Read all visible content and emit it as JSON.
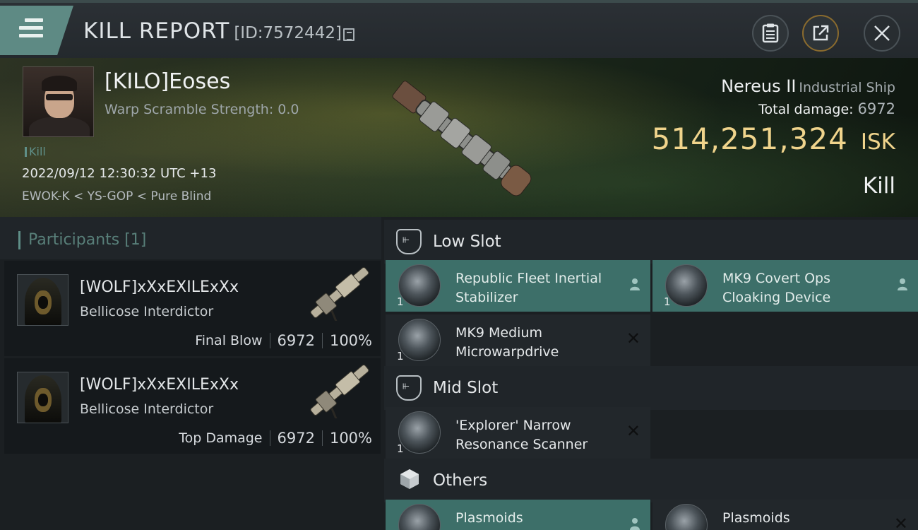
{
  "header": {
    "title": "KILL REPORT",
    "report_id": "[ID:7572442]",
    "buttons": {
      "menu": "menu-icon",
      "clipboard": "clipboard-icon",
      "share": "share-icon",
      "close": "close-icon"
    }
  },
  "victim": {
    "name": "[KILO]Eoses",
    "warp_scramble": "Warp Scramble Strength: 0.0",
    "tag": "Kill",
    "datetime": "2022/09/12 12:30:32 UTC +13",
    "location": "EWOK-K < YS-GOP < Pure Blind"
  },
  "ship": {
    "name": "Nereus II",
    "class": "Industrial Ship",
    "total_damage_label": "Total damage:",
    "total_damage": "6972",
    "isk_value": "514,251,324",
    "isk_unit": "ISK",
    "result": "Kill"
  },
  "participants": {
    "header": "Participants [1]",
    "rows": [
      {
        "name": "[WOLF]xXxEXILExXx",
        "ship": "Bellicose Interdictor",
        "role": "Final Blow",
        "damage": "6972",
        "percent": "100%"
      },
      {
        "name": "[WOLF]xXxEXILExXx",
        "ship": "Bellicose Interdictor",
        "role": "Top Damage",
        "damage": "6972",
        "percent": "100%"
      }
    ]
  },
  "slots": {
    "low": {
      "title": "Low Slot",
      "items": [
        {
          "name": "Republic Fleet Inertial Stabilizer",
          "qty": "1",
          "state": "dropped"
        },
        {
          "name": "MK9 Covert Ops Cloaking Device",
          "qty": "1",
          "state": "dropped"
        },
        {
          "name": "MK9 Medium Microwarpdrive",
          "qty": "1",
          "state": "destroyed"
        }
      ]
    },
    "mid": {
      "title": "Mid Slot",
      "items": [
        {
          "name": "'Explorer' Narrow Resonance Scanner",
          "qty": "1",
          "state": "destroyed"
        }
      ]
    },
    "others": {
      "title": "Others",
      "items": [
        {
          "name": "Plasmoids",
          "qty": "",
          "state": "dropped"
        },
        {
          "name": "Plasmoids",
          "qty": "",
          "state": "destroyed"
        }
      ]
    }
  },
  "colors": {
    "accent_teal": "#5e8a84",
    "dropped_bg": "#3d6f69",
    "isk_gold": "#f0d48c"
  }
}
